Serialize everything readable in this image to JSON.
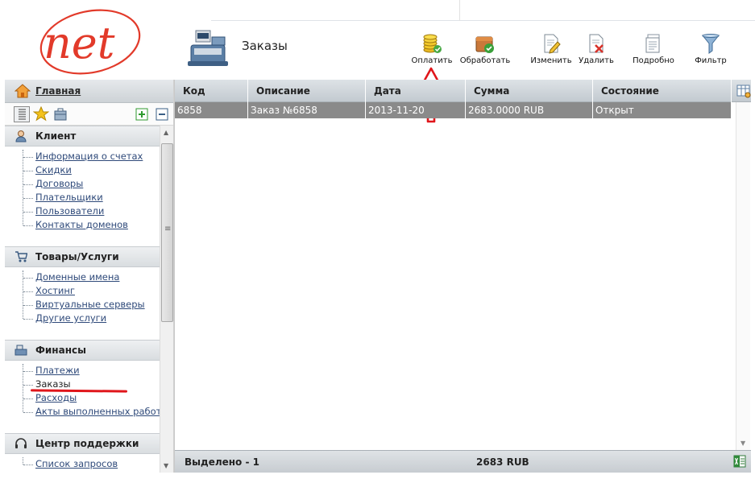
{
  "brand": {
    "logo_text": "net"
  },
  "header": {
    "title": "Заказы"
  },
  "toolbar": [
    {
      "label": "Оплатить",
      "icon": "coins-pay-icon"
    },
    {
      "label": "Обработать",
      "icon": "process-box-icon"
    },
    {
      "label": "Изменить",
      "icon": "edit-document-icon"
    },
    {
      "label": "Удалить",
      "icon": "delete-document-icon"
    },
    {
      "label": "Подробно",
      "icon": "details-document-icon"
    },
    {
      "label": "Фильтр",
      "icon": "filter-funnel-icon"
    }
  ],
  "sidebar": {
    "home_label": "Главная",
    "sections": [
      {
        "title": "Клиент",
        "icon": "user-icon",
        "items": [
          "Информация о счетах",
          "Скидки",
          "Договоры",
          "Плательщики",
          "Пользователи",
          "Контакты доменов"
        ]
      },
      {
        "title": "Товары/Услуги",
        "icon": "cart-icon",
        "items": [
          "Доменные имена",
          "Хостинг",
          "Виртуальные серверы",
          "Другие услуги"
        ]
      },
      {
        "title": "Финансы",
        "icon": "cash-register-icon",
        "items": [
          "Платежи",
          "Заказы",
          "Расходы",
          "Акты выполненных работ"
        ],
        "current": "Заказы"
      },
      {
        "title": "Центр поддержки",
        "icon": "headset-icon",
        "items": [
          "Список запросов"
        ]
      }
    ]
  },
  "table": {
    "columns": [
      "Код",
      "Описание",
      "Дата",
      "Сумма",
      "Состояние"
    ],
    "rows": [
      {
        "code": "6858",
        "description": "Заказ №6858",
        "date": "2013-11-20",
        "sum": "2683.0000 RUB",
        "status": "Открыт"
      }
    ],
    "footer": {
      "selected": "Выделено - 1",
      "total": "2683 RUB"
    }
  },
  "colors": {
    "accent_red": "#e0161b",
    "selected_row": "#8a8a8a",
    "header_bg": "#c3cad0"
  }
}
